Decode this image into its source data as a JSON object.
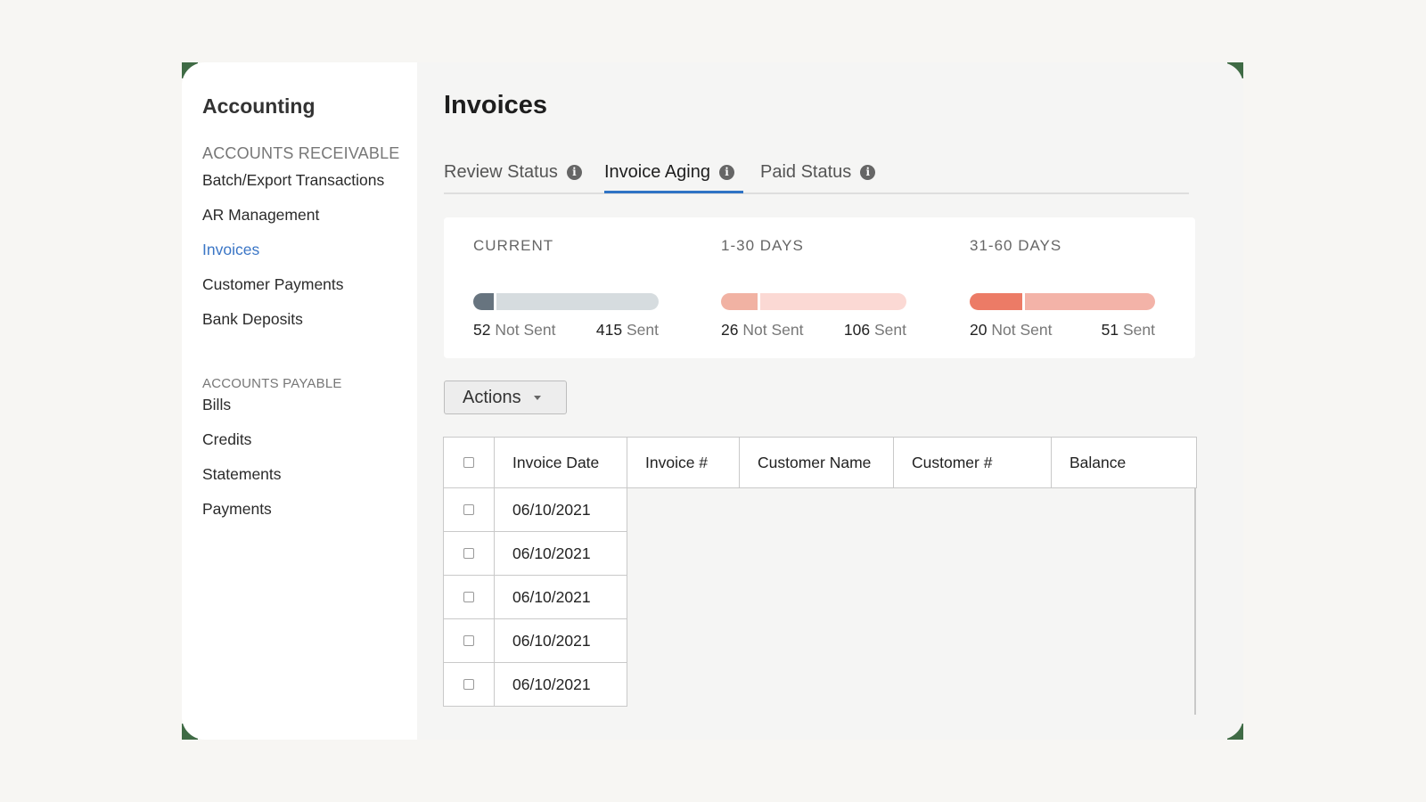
{
  "sidebar": {
    "title": "Accounting",
    "sections": [
      {
        "label": "ACCOUNTS RECEIVABLE",
        "items": [
          "Batch/Export Transactions",
          "AR Management",
          "Invoices",
          "Customer Payments",
          "Bank Deposits"
        ]
      },
      {
        "label": "ACCOUNTS PAYABLE",
        "items": [
          "Bills",
          "Credits",
          "Statements",
          "Payments"
        ]
      }
    ],
    "active_item": "Invoices"
  },
  "main": {
    "title": "Invoices",
    "tabs": [
      {
        "label": "Review Status",
        "info_icon": "info-icon"
      },
      {
        "label": "Invoice Aging",
        "info_icon": "info-icon",
        "active": true
      },
      {
        "label": "Paid Status",
        "info_icon": "info-icon"
      }
    ],
    "aging_summary": [
      {
        "label": "CURRENT",
        "not_sent": "52",
        "sent": "415",
        "not_sent_label": "Not Sent",
        "sent_label": "Sent",
        "color_not_sent": "#67747f",
        "color_sent": "#d6dcdf"
      },
      {
        "label": "1-30 DAYS",
        "not_sent": "26",
        "sent": "106",
        "not_sent_label": "Not Sent",
        "sent_label": "Sent",
        "color_not_sent": "#f1b2a3",
        "color_sent": "#fbd9d4"
      },
      {
        "label": "31-60 DAYS",
        "not_sent": "20",
        "sent": "51",
        "not_sent_label": "Not Sent",
        "sent_label": "Sent",
        "color_not_sent": "#ec7b66",
        "color_sent": "#f3b3a8"
      }
    ],
    "actions_label": "Actions",
    "table": {
      "columns": [
        "Invoice Date",
        "Invoice #",
        "Customer Name",
        "Customer #",
        "Balance"
      ],
      "rows": [
        "06/10/2021",
        "06/10/2021",
        "06/10/2021",
        "06/10/2021",
        "06/10/2021"
      ]
    }
  },
  "colors": {
    "accent": "#2f73c5",
    "active_nav": "#3b76c6",
    "frame_corner": "#3f6b45"
  }
}
